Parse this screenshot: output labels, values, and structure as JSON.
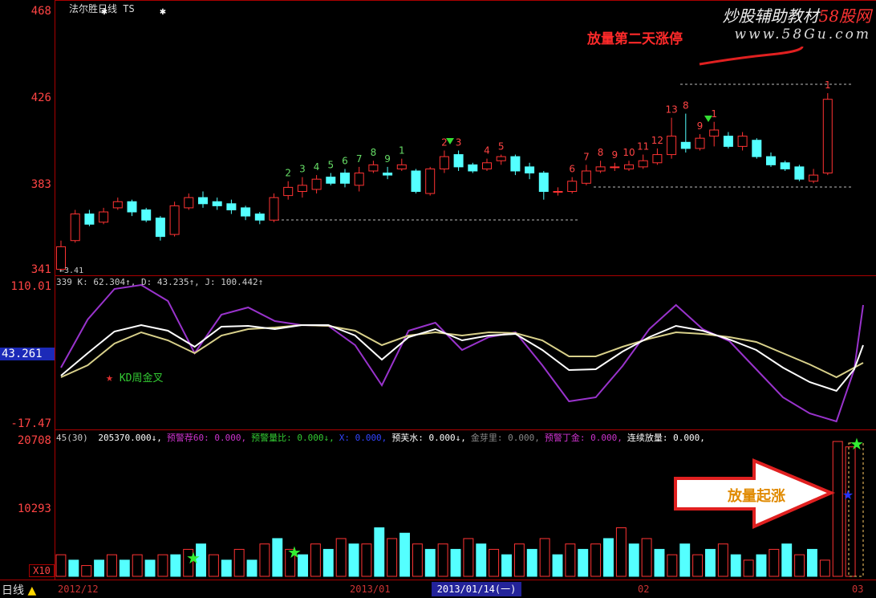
{
  "stock": {
    "name": "法尔胜日线 TS"
  },
  "price_axis": {
    "labels": [
      "468",
      "426",
      "383",
      "341"
    ]
  },
  "kd_axis": {
    "labels": [
      "110.01",
      "43.261",
      "-17.47"
    ]
  },
  "vol_axis": {
    "labels": [
      "20708",
      "10293",
      "X10"
    ]
  },
  "price_annotations": {
    "low_label": "←3.41"
  },
  "kd_indicator": {
    "header": "339 K: 62.304↑, D: 43.235↑, J: 100.442↑",
    "legend": "KD周金叉"
  },
  "vol_indicator": {
    "header_prefix": "45(30)",
    "items": [
      {
        "text": "205370.000↓,",
        "color": "#ffffff"
      },
      {
        "text": "预警荐60: 0.000,",
        "color": "#cc33cc"
      },
      {
        "text": "预警量比: 0.000↓,",
        "color": "#33cc33"
      },
      {
        "text": "X: 0.000,",
        "color": "#3344ff"
      },
      {
        "text": "预芙水: 0.000↓,",
        "color": "#ffffff"
      },
      {
        "text": "金芽里: 0.000,",
        "color": "#888888"
      },
      {
        "text": "预警丁金: 0.000,",
        "color": "#cc33cc"
      },
      {
        "text": "连续放量: 0.000,",
        "color": "#ffffff"
      }
    ],
    "callout": "放量起涨"
  },
  "watermark": {
    "line1_a": "炒股辅助教材",
    "line1_b": "58股网",
    "line2": "www.58Gu.com",
    "red_note": "放量第二天涨停"
  },
  "timeline": {
    "period": "日线",
    "dates": [
      "2012/12",
      "2013/01",
      "02",
      "03"
    ],
    "selected": "2013/01/14(一)"
  },
  "colors": {
    "up": "#ff3333",
    "down": "#54ffff",
    "kline_outline_up": "#ff5050",
    "k_line": "#ffffff",
    "d_line": "#d8d08a",
    "j_line": "#9933cc"
  },
  "candles": [
    {
      "o": 342,
      "c": 353,
      "h": 356,
      "l": 341,
      "n": ""
    },
    {
      "o": 356,
      "c": 369,
      "h": 371,
      "l": 355,
      "n": ""
    },
    {
      "o": 369,
      "c": 364,
      "h": 371,
      "l": 363,
      "n": ""
    },
    {
      "o": 365,
      "c": 370,
      "h": 372,
      "l": 364,
      "n": ""
    },
    {
      "o": 372,
      "c": 375,
      "h": 377,
      "l": 371,
      "n": ""
    },
    {
      "o": 375,
      "c": 370,
      "h": 376,
      "l": 368,
      "n": ""
    },
    {
      "o": 371,
      "c": 366,
      "h": 372,
      "l": 365,
      "n": ""
    },
    {
      "o": 367,
      "c": 358,
      "h": 368,
      "l": 356,
      "n": ""
    },
    {
      "o": 359,
      "c": 373,
      "h": 375,
      "l": 358,
      "n": ""
    },
    {
      "o": 372,
      "c": 377,
      "h": 379,
      "l": 371,
      "n": ""
    },
    {
      "o": 377,
      "c": 374,
      "h": 380,
      "l": 372,
      "n": ""
    },
    {
      "o": 375,
      "c": 373,
      "h": 377,
      "l": 371,
      "n": ""
    },
    {
      "o": 374,
      "c": 371,
      "h": 376,
      "l": 369,
      "n": ""
    },
    {
      "o": 372,
      "c": 368,
      "h": 373,
      "l": 366,
      "n": ""
    },
    {
      "o": 369,
      "c": 366,
      "h": 370,
      "l": 364,
      "n": ""
    },
    {
      "o": 366,
      "c": 377,
      "h": 379,
      "l": 365,
      "n": ""
    },
    {
      "o": 378,
      "c": 382,
      "h": 385,
      "l": 376,
      "n": "2"
    },
    {
      "o": 380,
      "c": 383,
      "h": 387,
      "l": 377,
      "n": "3"
    },
    {
      "o": 381,
      "c": 386,
      "h": 388,
      "l": 379,
      "n": "4"
    },
    {
      "o": 387,
      "c": 384,
      "h": 389,
      "l": 383,
      "n": "5"
    },
    {
      "o": 389,
      "c": 384,
      "h": 391,
      "l": 382,
      "n": "6"
    },
    {
      "o": 383,
      "c": 389,
      "h": 392,
      "l": 380,
      "n": "7"
    },
    {
      "o": 390,
      "c": 393,
      "h": 395,
      "l": 389,
      "n": "8"
    },
    {
      "o": 389,
      "c": 388,
      "h": 392,
      "l": 386,
      "n": "9"
    },
    {
      "o": 391,
      "c": 393,
      "h": 396,
      "l": 390,
      "n": "1"
    },
    {
      "o": 390,
      "c": 380,
      "h": 391,
      "l": 379,
      "n": ""
    },
    {
      "o": 379,
      "c": 391,
      "h": 392,
      "l": 378,
      "n": ""
    },
    {
      "o": 391,
      "c": 397,
      "h": 400,
      "l": 389,
      "n": "2"
    },
    {
      "o": 398,
      "c": 392,
      "h": 400,
      "l": 390,
      "n": "3"
    },
    {
      "o": 393,
      "c": 390,
      "h": 394,
      "l": 389,
      "n": ""
    },
    {
      "o": 391,
      "c": 394,
      "h": 396,
      "l": 390,
      "n": "4"
    },
    {
      "o": 395,
      "c": 397,
      "h": 398,
      "l": 393,
      "n": "5"
    },
    {
      "o": 397,
      "c": 390,
      "h": 398,
      "l": 388,
      "n": ""
    },
    {
      "o": 392,
      "c": 389,
      "h": 394,
      "l": 386,
      "n": ""
    },
    {
      "o": 389,
      "c": 380,
      "h": 390,
      "l": 376,
      "n": ""
    },
    {
      "o": 380,
      "c": 380,
      "h": 382,
      "l": 378,
      "n": ""
    },
    {
      "o": 380,
      "c": 385,
      "h": 387,
      "l": 379,
      "n": "6"
    },
    {
      "o": 384,
      "c": 390,
      "h": 393,
      "l": 383,
      "n": "7"
    },
    {
      "o": 390,
      "c": 392,
      "h": 395,
      "l": 389,
      "n": "8"
    },
    {
      "o": 392,
      "c": 392,
      "h": 394,
      "l": 390,
      "n": "9"
    },
    {
      "o": 391,
      "c": 393,
      "h": 395,
      "l": 390,
      "n": "10"
    },
    {
      "o": 392,
      "c": 395,
      "h": 398,
      "l": 391,
      "n": "11"
    },
    {
      "o": 394,
      "c": 398,
      "h": 401,
      "l": 393,
      "n": "12"
    },
    {
      "o": 398,
      "c": 407,
      "h": 416,
      "l": 396,
      "n": "13"
    },
    {
      "o": 404,
      "c": 401,
      "h": 418,
      "l": 399,
      "n": "8"
    },
    {
      "o": 401,
      "c": 406,
      "h": 408,
      "l": 400,
      "n": "9"
    },
    {
      "o": 407,
      "c": 410,
      "h": 414,
      "l": 402,
      "n": "1"
    },
    {
      "o": 407,
      "c": 402,
      "h": 409,
      "l": 401,
      "n": ""
    },
    {
      "o": 402,
      "c": 407,
      "h": 409,
      "l": 400,
      "n": ""
    },
    {
      "o": 405,
      "c": 397,
      "h": 406,
      "l": 396,
      "n": ""
    },
    {
      "o": 397,
      "c": 393,
      "h": 399,
      "l": 392,
      "n": ""
    },
    {
      "o": 394,
      "c": 391,
      "h": 395,
      "l": 390,
      "n": ""
    },
    {
      "o": 392,
      "c": 386,
      "h": 393,
      "l": 385,
      "n": ""
    },
    {
      "o": 385,
      "c": 388,
      "h": 391,
      "l": 384,
      "n": ""
    },
    {
      "o": 389,
      "c": 425,
      "h": 428,
      "l": 388,
      "n": "1"
    }
  ],
  "volumes": [
    4,
    3,
    2,
    3,
    4,
    3,
    4,
    3,
    4,
    4,
    5,
    6,
    4,
    3,
    5,
    3,
    6,
    7,
    5,
    4,
    6,
    5,
    7,
    6,
    6,
    9,
    7,
    8,
    6,
    5,
    6,
    5,
    7,
    6,
    5,
    4,
    6,
    5,
    7,
    4,
    6,
    5,
    6,
    7,
    9,
    6,
    7,
    5,
    4,
    6,
    4,
    5,
    6,
    4,
    3,
    4,
    5,
    6,
    4,
    5,
    3,
    25,
    24
  ]
}
